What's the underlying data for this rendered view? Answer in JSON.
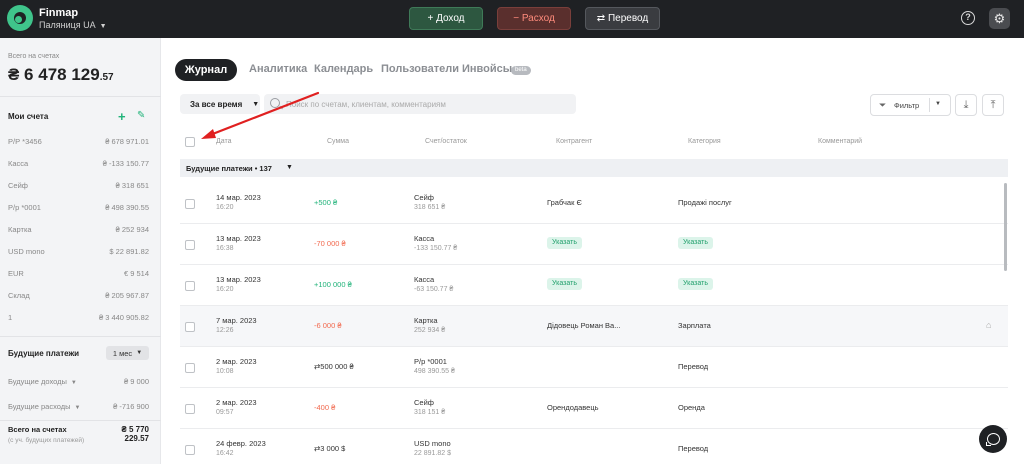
{
  "header": {
    "brand": "Finmap",
    "company": "Паляниця UA",
    "income_btn": "+ Доход",
    "expense_btn": "− Расход",
    "transfer_btn": "⇄ Перевод",
    "help_icon": "question-icon",
    "settings_icon": "gear-icon"
  },
  "sidebar": {
    "total_label": "Всего на счетах",
    "total_main": "₴ 6 478 129",
    "total_cents": ".57",
    "accounts_title": "Мои счета",
    "accounts": [
      {
        "name": "Р/Р *3456",
        "balance": "₴ 678 971.01"
      },
      {
        "name": "Касса",
        "balance": "₴ -133 150.77"
      },
      {
        "name": "Сейф",
        "balance": "₴ 318 651"
      },
      {
        "name": "Р/р *0001",
        "balance": "₴ 498 390.55"
      },
      {
        "name": "Картка",
        "balance": "₴ 252 934"
      },
      {
        "name": "USD mono",
        "balance": "$ 22 891.82"
      },
      {
        "name": "EUR",
        "balance": "€ 9 514"
      },
      {
        "name": "Склад",
        "balance": "₴ 205 967.87"
      },
      {
        "name": "1",
        "balance": "₴ 3 440 905.82"
      }
    ],
    "future_title": "Будущие платежи",
    "future_period": "1 мес",
    "future_rows": [
      {
        "name": "Будущие доходы",
        "balance": "₴ 9 000"
      },
      {
        "name": "Будущие расходы",
        "balance": "₴ -716 900"
      }
    ],
    "sum_label": "Всего на счетах",
    "sum_note": "(с уч. будущих платежей)",
    "sum_value": "₴ 5 770 229.57"
  },
  "tabs": {
    "journal": "Журнал",
    "analytics": "Аналитика",
    "calendar": "Календарь",
    "users": "Пользователи",
    "invoices": "Инвойсы",
    "beta": "beta"
  },
  "toolbar": {
    "period": "За все время",
    "search_placeholder": "Поиск по счетам, клиентам, комментариям",
    "filter": "Фильтр"
  },
  "table": {
    "headers": {
      "date": "Дата",
      "amount": "Сумма",
      "account": "Счет/остаток",
      "counterparty": "Контрагент",
      "category": "Категория",
      "comment": "Комментарий"
    },
    "group": "Будущие платежи • 137",
    "rows": [
      {
        "date": "14 мар. 2023",
        "time": "16:20",
        "amount": "+500 ₴",
        "amount_type": "inc",
        "account": "Сейф",
        "account_balance": "318 651 ₴",
        "counterparty": "Грабчак Є",
        "counterparty_pill": "",
        "category": "Продажі послуг",
        "category_pill": ""
      },
      {
        "date": "13 мар. 2023",
        "time": "16:38",
        "amount": "-70 000 ₴",
        "amount_type": "exp",
        "account": "Касса",
        "account_balance": "-133 150.77 ₴",
        "counterparty": "",
        "counterparty_pill": "Указать",
        "category": "",
        "category_pill": "Указать"
      },
      {
        "date": "13 мар. 2023",
        "time": "16:20",
        "amount": "+100 000 ₴",
        "amount_type": "inc",
        "account": "Касса",
        "account_balance": "-63 150.77 ₴",
        "counterparty": "",
        "counterparty_pill": "Указать",
        "category": "",
        "category_pill": "Указать"
      },
      {
        "date": "7 мар. 2023",
        "time": "12:26",
        "amount": "-6 000 ₴",
        "amount_type": "exp",
        "account": "Картка",
        "account_balance": "252 934 ₴",
        "counterparty": "Дідовець Роман Ва...",
        "counterparty_pill": "",
        "category": "Зарплата",
        "category_pill": ""
      },
      {
        "date": "2 мар. 2023",
        "time": "10:08",
        "amount": "⇄500 000 ₴",
        "amount_type": "trf",
        "account": "Р/р *0001",
        "account_balance": "498 390.55 ₴",
        "counterparty": "",
        "counterparty_pill": "",
        "category": "Перевод",
        "category_pill": ""
      },
      {
        "date": "2 мар. 2023",
        "time": "09:57",
        "amount": "-400 ₴",
        "amount_type": "exp",
        "account": "Сейф",
        "account_balance": "318 151 ₴",
        "counterparty": "Орендодавець",
        "counterparty_pill": "",
        "category": "Оренда",
        "category_pill": ""
      },
      {
        "date": "24 февр. 2023",
        "time": "16:42",
        "amount": "⇄3 000 $",
        "amount_type": "trf",
        "account": "USD mono",
        "account_balance": "22 891.82 $",
        "counterparty": "",
        "counterparty_pill": "",
        "category": "Перевод",
        "category_pill": ""
      }
    ]
  },
  "colors": {
    "accent_green": "#21b37a",
    "expense_red": "#f26a4f",
    "topbar": "#1f2124",
    "annotation_arrow": "#e02020"
  }
}
